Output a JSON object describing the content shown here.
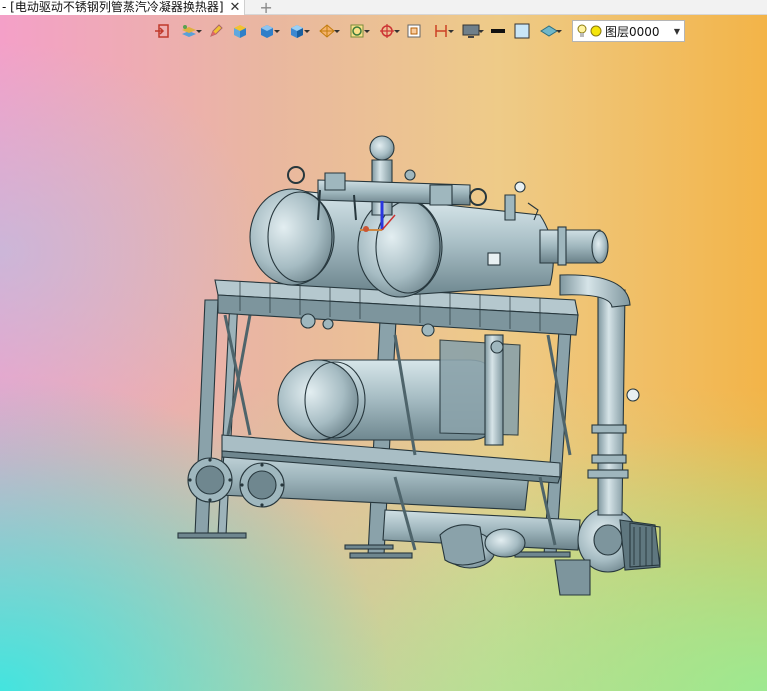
{
  "tab": {
    "title": "- [电动驱动不锈钢列管蒸汽冷凝器换热器]",
    "close": "✕",
    "add": "+"
  },
  "toolbar": {
    "icons": [
      "import-icon",
      "layers-icon",
      "pencil-icon",
      "solid-box-icon",
      "cube-icon",
      "view-cube-icon",
      "render-style-icon",
      "section-icon",
      "snap-icon",
      "frame-icon",
      "dimension-icon",
      "display-icon",
      "line-color-icon",
      "fill-color-icon",
      "plane-icon"
    ],
    "layer": {
      "value": "图层0000"
    }
  },
  "colors": {
    "metal": "#9fb7be",
    "metal_dark": "#27373d",
    "accent_blue": "#2a36e0"
  }
}
